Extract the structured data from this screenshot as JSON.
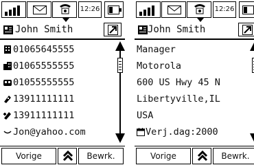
{
  "status_bar": {
    "time": "12:26",
    "icons": [
      "signal-icon",
      "mail-icon",
      "phone-icon",
      "battery-icon"
    ]
  },
  "left_panel": {
    "header": {
      "name": "John Smith",
      "icon": "contact-card-icon",
      "button_icon": "edit-arrow-icon"
    },
    "rows": [
      {
        "icon": "office-building-icon",
        "value": "01065645555"
      },
      {
        "icon": "home-building-icon",
        "value": "01065555555"
      },
      {
        "icon": "fax-icon",
        "value": "01055555555"
      },
      {
        "icon": "mobile-phone-icon",
        "value": "13911111111"
      },
      {
        "icon": "mobile-phone-alt-icon",
        "value": "13911111111"
      },
      {
        "icon": "email-icon",
        "value": "Jon@yahoo.com"
      }
    ],
    "scrollbar_position": 0.3,
    "softkeys": {
      "left": "Vorige",
      "center_icon": "up-chevron-icon",
      "right": "Bewrk."
    }
  },
  "right_panel": {
    "header": {
      "name": "John Smith",
      "icon": "contact-card-icon",
      "button_icon": "edit-arrow-icon"
    },
    "rows": [
      {
        "value": "Manager"
      },
      {
        "value": "Motorola"
      },
      {
        "value": "600 US Hwy 45 N"
      },
      {
        "value": "Libertyville,IL"
      },
      {
        "value": "USA"
      },
      {
        "icon": "calendar-icon",
        "value": "Verj.dag:2000"
      }
    ],
    "scrollbar_position": 0.3,
    "softkeys": {
      "left": "Vorige",
      "center_icon": "up-chevron-icon",
      "right": "Bewrk."
    }
  }
}
